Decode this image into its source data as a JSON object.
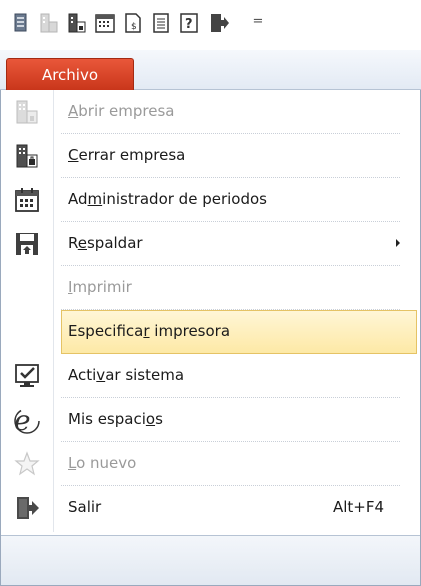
{
  "toolbar": {
    "buttons": [
      "app-icon",
      "open-company-icon",
      "close-company-icon",
      "periods-icon",
      "invoice-icon",
      "document-icon",
      "help-icon",
      "exit-icon"
    ],
    "more": "="
  },
  "ribbon": {
    "file_tab": "Archivo"
  },
  "menu": {
    "items": [
      {
        "pre": "",
        "u": "A",
        "post": "brir empresa",
        "disabled": true,
        "icon": "open-company-icon"
      },
      {
        "pre": "",
        "u": "C",
        "post": "errar empresa",
        "disabled": false,
        "icon": "close-company-icon"
      },
      {
        "pre": "Ad",
        "u": "m",
        "post": "inistrador de periodos",
        "disabled": false,
        "icon": "calendar-icon"
      },
      {
        "pre": "R",
        "u": "e",
        "post": "spaldar",
        "disabled": false,
        "icon": "backup-icon",
        "submenu": true
      },
      {
        "pre": "",
        "u": "I",
        "post": "mprimir",
        "disabled": true,
        "icon": ""
      },
      {
        "pre": "Especifica",
        "u": "r",
        "post": " impresora",
        "disabled": false,
        "icon": "",
        "highlighted": true
      },
      {
        "pre": "Acti",
        "u": "v",
        "post": "ar sistema",
        "disabled": false,
        "icon": "activate-icon"
      },
      {
        "pre": "Mis espaci",
        "u": "o",
        "post": "s",
        "disabled": false,
        "icon": "spaces-icon"
      },
      {
        "pre": "",
        "u": "L",
        "post": "o nuevo",
        "disabled": true,
        "icon": "star-icon"
      },
      {
        "pre": "Salir",
        "u": "",
        "post": "",
        "disabled": false,
        "icon": "exit-icon",
        "shortcut": "Alt+F4"
      }
    ]
  }
}
